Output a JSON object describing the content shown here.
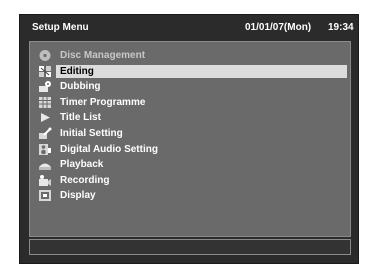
{
  "header": {
    "title": "Setup Menu",
    "date": "01/01/07(Mon)",
    "time": "19:34"
  },
  "menu": {
    "selected_index": 1,
    "items": [
      {
        "label": "Disc Management",
        "icon": "disc-icon",
        "state": "disabled"
      },
      {
        "label": "Editing",
        "icon": "editing-icon",
        "state": "selected"
      },
      {
        "label": "Dubbing",
        "icon": "dubbing-icon",
        "state": "normal"
      },
      {
        "label": "Timer Programme",
        "icon": "timer-grid-icon",
        "state": "normal"
      },
      {
        "label": "Title List",
        "icon": "play-triangle-icon",
        "state": "normal"
      },
      {
        "label": "Initial Setting",
        "icon": "wrench-icon",
        "state": "normal"
      },
      {
        "label": "Digital Audio Setting",
        "icon": "audio-icon",
        "state": "normal"
      },
      {
        "label": "Playback",
        "icon": "playback-icon",
        "state": "normal"
      },
      {
        "label": "Recording",
        "icon": "recording-icon",
        "state": "normal"
      },
      {
        "label": "Display",
        "icon": "display-icon",
        "state": "normal"
      }
    ]
  },
  "colors": {
    "background": "#2b2b2b",
    "panel": "#6a6a6a",
    "highlight": "#dcdcdc"
  }
}
